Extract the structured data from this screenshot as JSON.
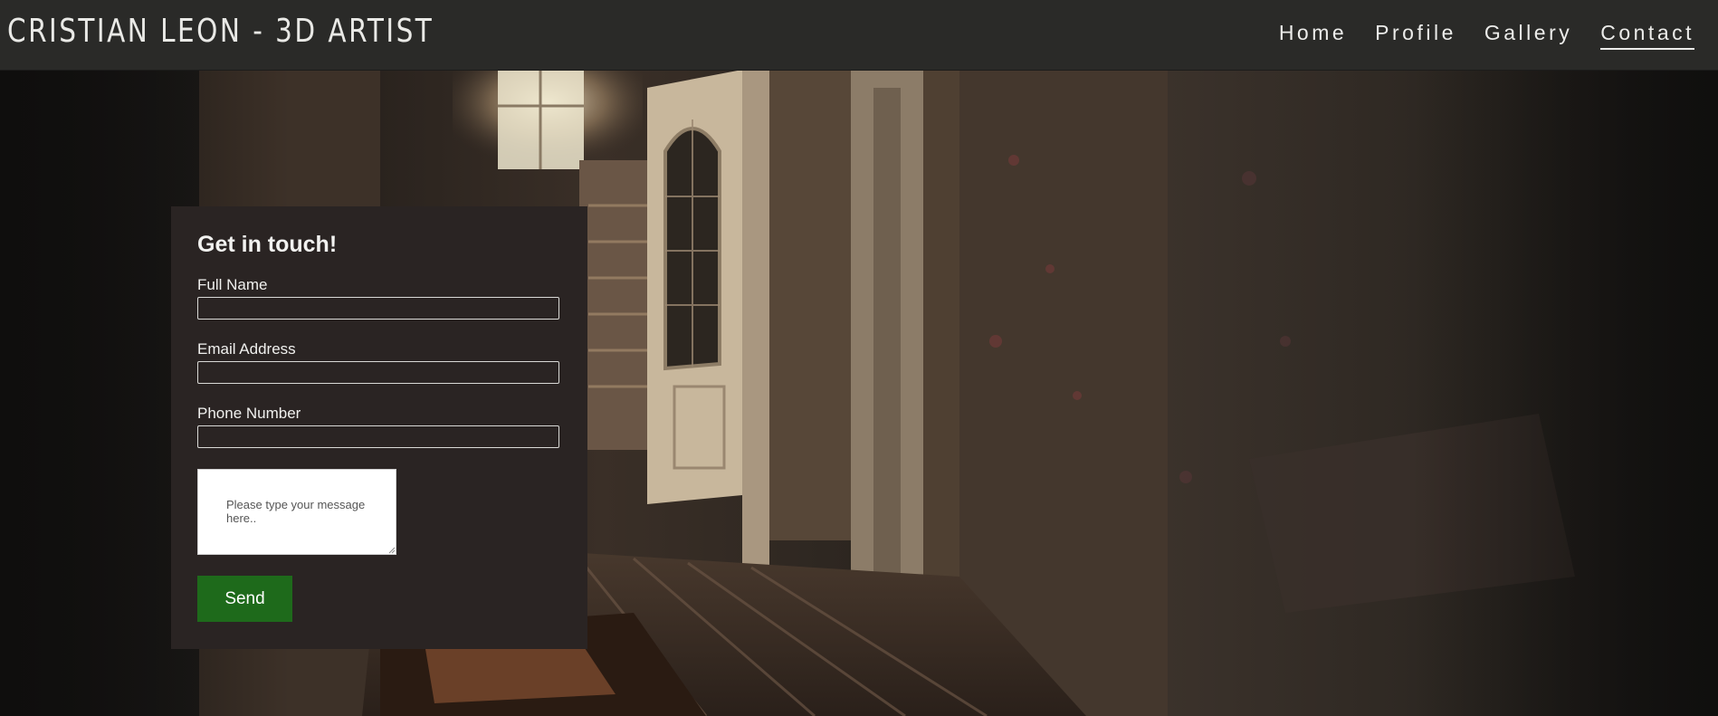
{
  "header": {
    "brand": "CRISTIAN LEON - 3D ARTIST",
    "nav": [
      {
        "label": "Home",
        "active": false
      },
      {
        "label": "Profile",
        "active": false
      },
      {
        "label": "Gallery",
        "active": false
      },
      {
        "label": "Contact",
        "active": true
      }
    ]
  },
  "contact_form": {
    "title": "Get in touch!",
    "full_name": {
      "label": "Full Name",
      "value": ""
    },
    "email": {
      "label": "Email Address",
      "value": ""
    },
    "phone": {
      "label": "Phone Number",
      "value": ""
    },
    "message": {
      "placeholder": "Please type your message here..",
      "value": ""
    },
    "send_label": "Send"
  },
  "colors": {
    "topbar_bg": "#2a2a28",
    "card_bg": "#2a2423",
    "send_button_bg": "#1e6a1b",
    "nav_text": "#ececea"
  },
  "background": {
    "image": "abandoned-house-hallway-render",
    "icon": "background-scene"
  }
}
